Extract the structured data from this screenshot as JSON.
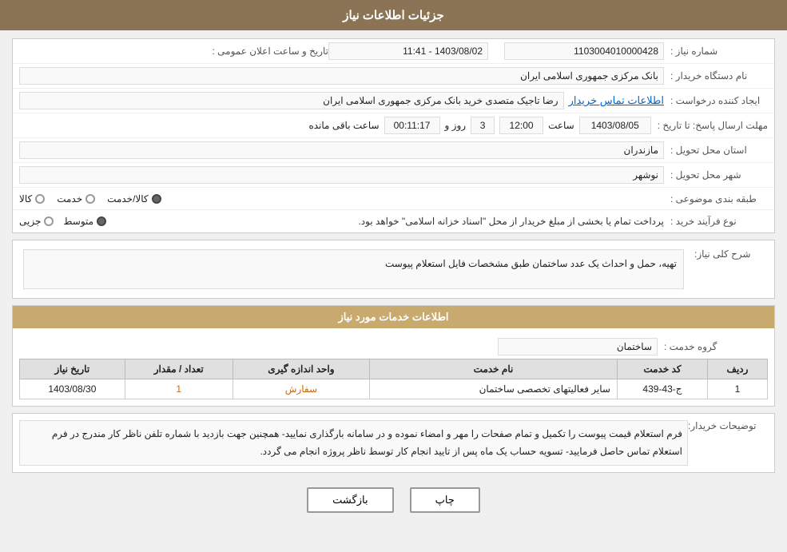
{
  "page": {
    "title": "جزئیات اطلاعات نیاز",
    "sections": {
      "main_info": {
        "fields": {
          "need_number_label": "شماره نیاز :",
          "need_number_value": "1103004010000428",
          "announce_datetime_label": "تاریخ و ساعت اعلان عمومی :",
          "announce_datetime_value": "1403/08/02 - 11:41",
          "buyer_name_label": "نام دستگاه خریدار :",
          "buyer_name_value": "بانک مرکزی جمهوری اسلامی ایران",
          "creator_label": "ایجاد کننده درخواست :",
          "creator_value": "رضا تاجیک متصدی خرید بانک مرکزی جمهوری اسلامی ایران",
          "contact_link": "اطلاعات تماس خریدار",
          "deadline_label": "مهلت ارسال پاسخ: تا تاریخ :",
          "deadline_date": "1403/08/05",
          "deadline_time": "12:00",
          "deadline_days": "3",
          "deadline_remaining": "00:11:17",
          "deadline_date_label": "",
          "deadline_time_label": "ساعت",
          "deadline_days_label": "روز و",
          "deadline_remaining_label": "ساعت باقی مانده",
          "province_label": "استان محل تحویل :",
          "province_value": "مازندران",
          "city_label": "شهر محل تحویل :",
          "city_value": "نوشهر",
          "category_label": "طبقه بندی موضوعی :",
          "category_kala": "کالا",
          "category_khadamat": "خدمت",
          "category_kala_khadamat": "کالا/خدمت",
          "category_selected": "kala_khadamat",
          "process_label": "نوع فرآیند خرید :",
          "process_jozvi": "جزیی",
          "process_motavasset": "متوسط",
          "process_selected": "motavasset",
          "process_description": "پرداخت تمام یا بخشی از مبلغ خریدار از محل \"اسناد خزانه اسلامی\" خواهد بود."
        }
      },
      "description": {
        "title": "شرح کلی نیاز:",
        "content": "تهیه، حمل و احداث یک عدد ساختمان طبق مشخصات فایل استعلام پیوست"
      },
      "services_info": {
        "title": "اطلاعات خدمات مورد نیاز",
        "group_label": "گروه خدمت :",
        "group_value": "ساختمان",
        "table": {
          "columns": [
            "ردیف",
            "کد خدمت",
            "نام خدمت",
            "واحد اندازه گیری",
            "تعداد / مقدار",
            "تاریخ نیاز"
          ],
          "rows": [
            {
              "row": "1",
              "code": "ج-43-439",
              "name": "سایر فعالیتهای تخصصی ساختمان",
              "unit": "سفارش",
              "quantity": "1",
              "date": "1403/08/30"
            }
          ]
        }
      },
      "buyer_notes": {
        "label": "توضیحات خریدار:",
        "content": "فرم استعلام قیمت پیوست را تکمیل و تمام صفحات را مهر و امضاء نموده و در سامانه بارگذاری نمایید- همچنین جهت بازدید با شماره تلفن ناظر کار مندرج در فرم استعلام تماس حاصل فرمایید- تسویه حساب یک ماه پس از تایید انجام کار توسط ناظر پروژه انجام می گردد."
      },
      "buttons": {
        "print": "چاپ",
        "back": "بازگشت"
      }
    }
  }
}
